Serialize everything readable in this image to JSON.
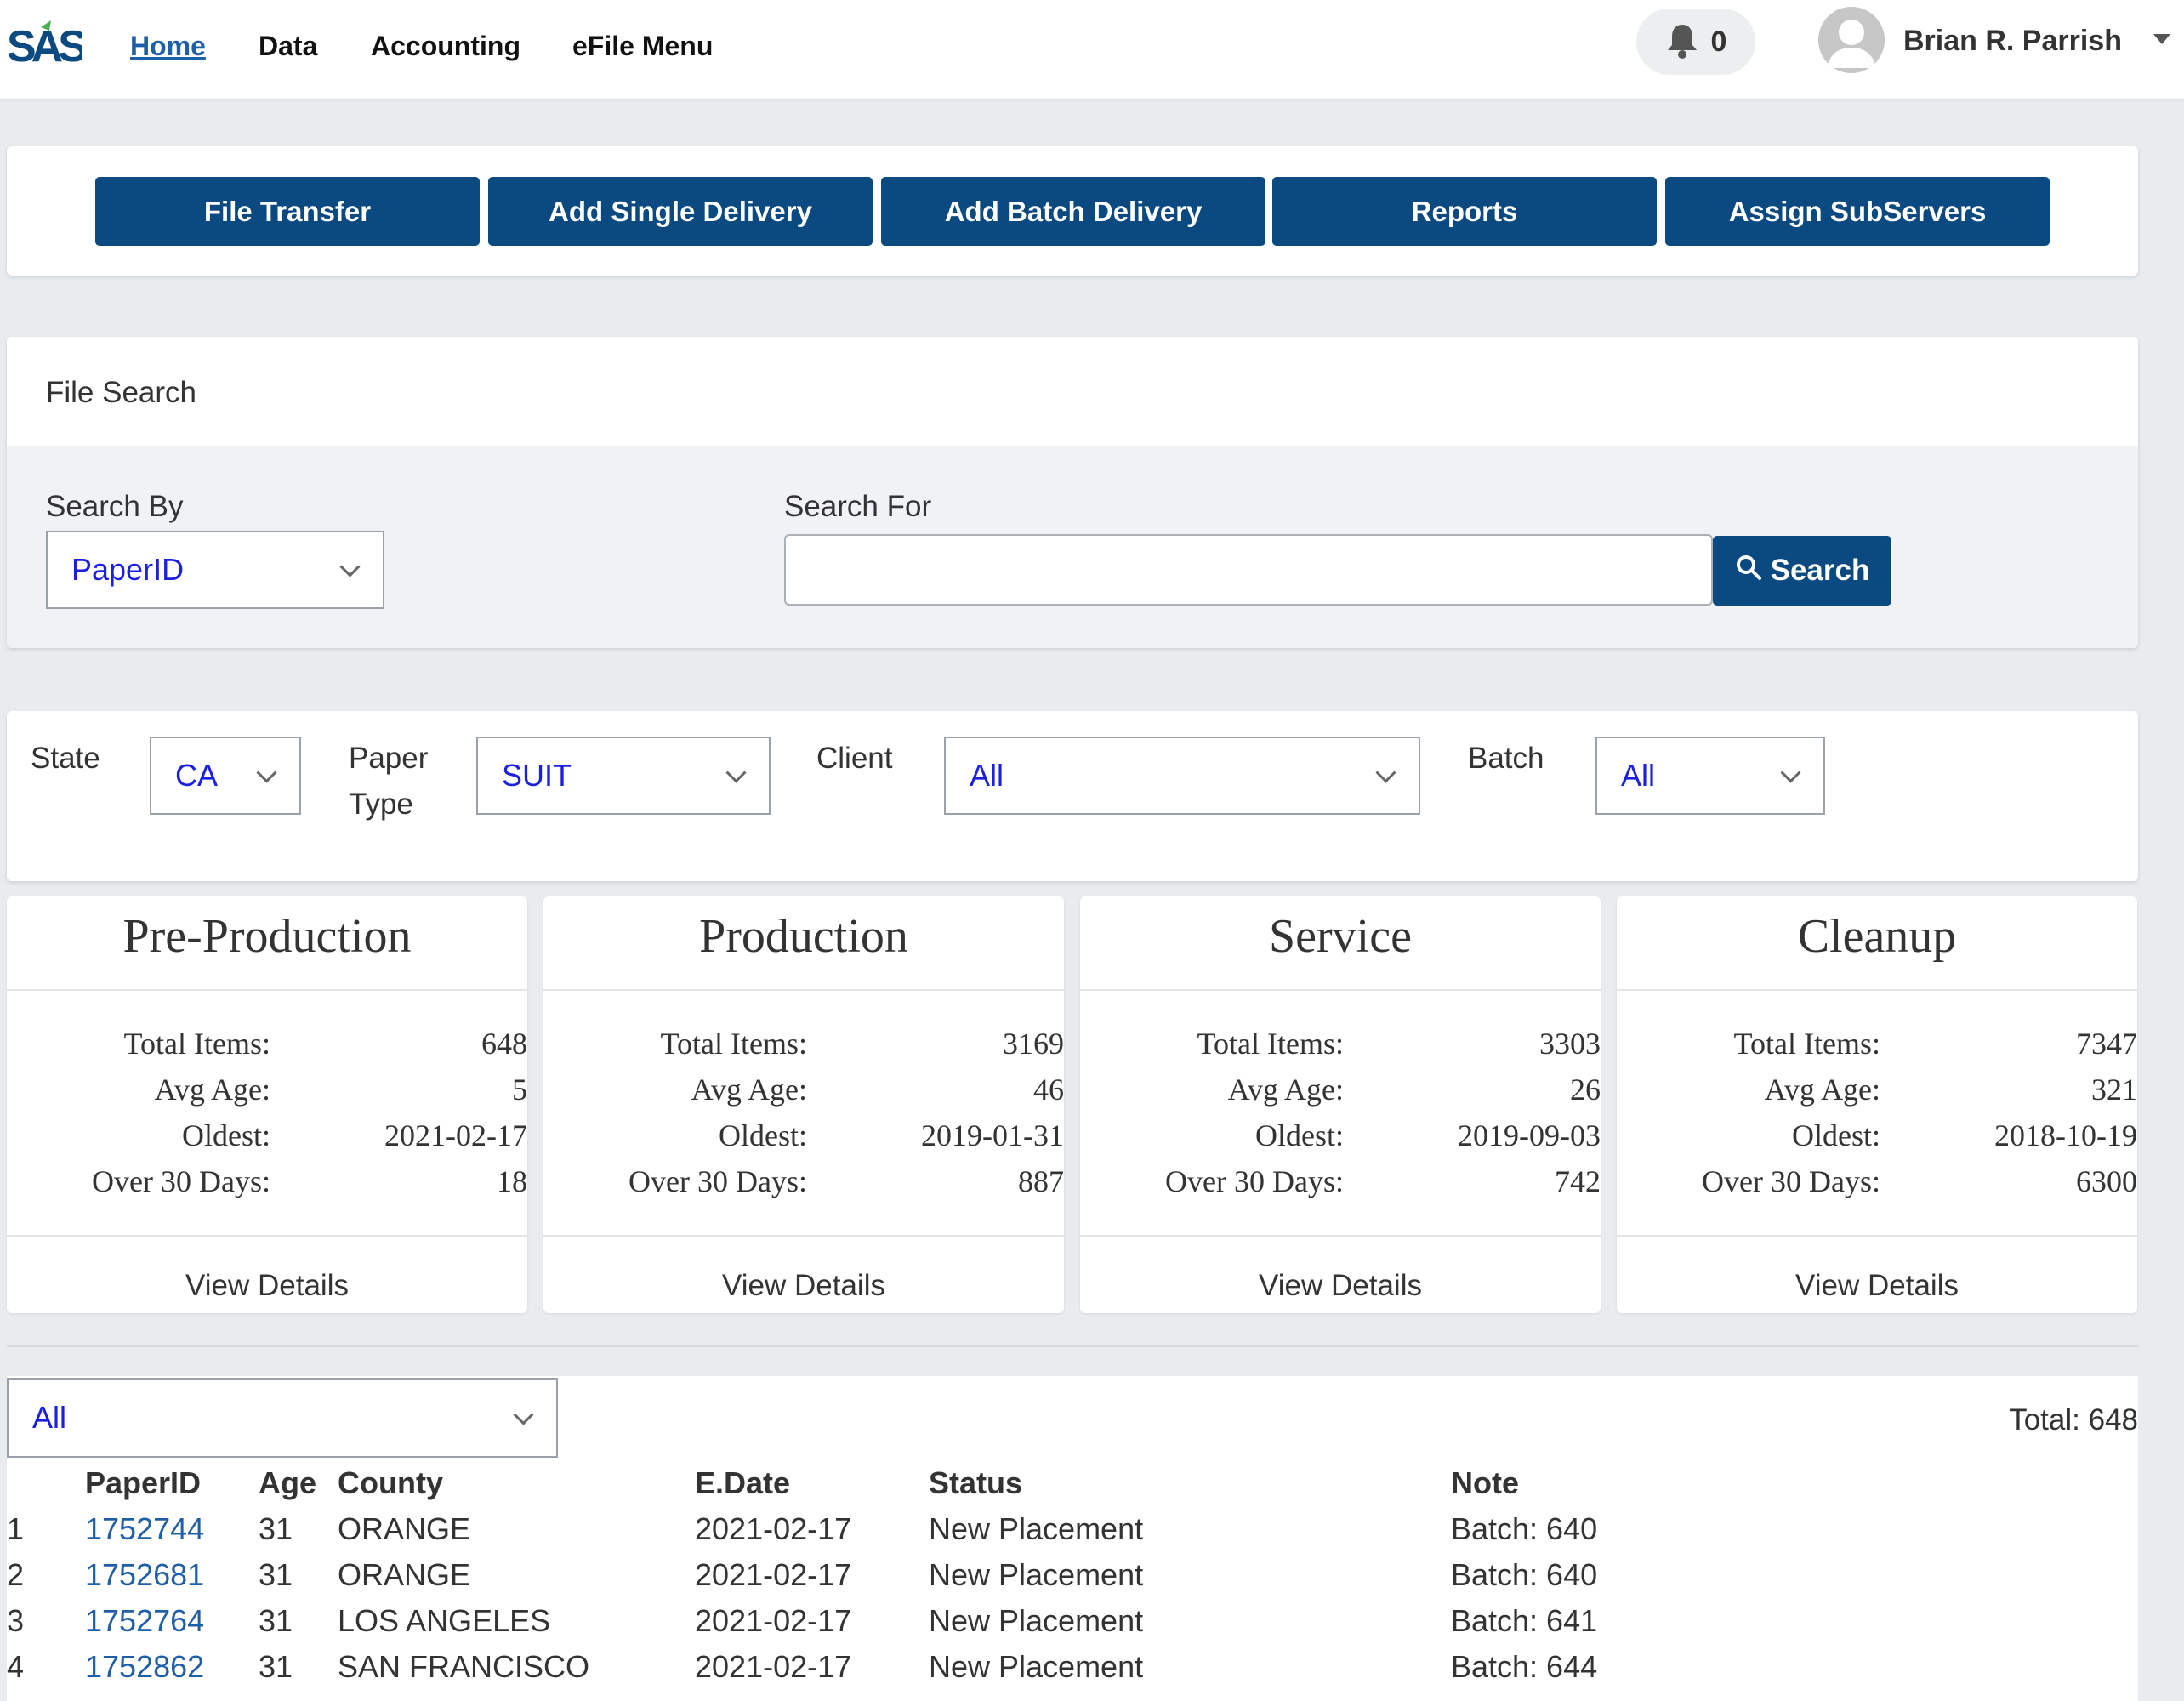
{
  "brand": {
    "logo_text": "SAS",
    "logo_color": "#0b4a80",
    "logo_accent_color": "#4caf50"
  },
  "nav": {
    "items": [
      {
        "label": "Home",
        "active": true
      },
      {
        "label": "Data"
      },
      {
        "label": "Accounting"
      },
      {
        "label": "eFile Menu"
      }
    ],
    "notification_icon": "bell-icon",
    "notification_count": "0",
    "user_name": "Brian R. Parrish",
    "avatar_icon": "user-avatar-icon",
    "user_menu_icon": "caret-down-icon"
  },
  "actions": [
    {
      "label": "File Transfer"
    },
    {
      "label": "Add Single Delivery"
    },
    {
      "label": "Add Batch Delivery"
    },
    {
      "label": "Reports"
    },
    {
      "label": "Assign SubServers"
    }
  ],
  "file_search": {
    "title": "File Search",
    "search_by_label": "Search By",
    "search_by_value": "PaperID",
    "search_for_label": "Search For",
    "search_for_value": "",
    "search_button": "Search",
    "search_icon": "search-icon"
  },
  "filters": {
    "state_label": "State",
    "state_value": "CA",
    "paper_type_label_line1": "Paper",
    "paper_type_label_line2": "Type",
    "paper_type_value": "SUIT",
    "client_label": "Client",
    "client_value": "All",
    "batch_label": "Batch",
    "batch_value": "All"
  },
  "stats_labels": {
    "total_items": "Total Items:",
    "avg_age": "Avg Age:",
    "oldest": "Oldest:",
    "over_30": "Over 30 Days:",
    "view_details": "View Details"
  },
  "stages": [
    {
      "title": "Pre-Production",
      "total_items": "648",
      "avg_age": "5",
      "oldest": "2021-02-17",
      "over_30": "18"
    },
    {
      "title": "Production",
      "total_items": "3169",
      "avg_age": "46",
      "oldest": "2019-01-31",
      "over_30": "887"
    },
    {
      "title": "Service",
      "total_items": "3303",
      "avg_age": "26",
      "oldest": "2019-09-03",
      "over_30": "742"
    },
    {
      "title": "Cleanup",
      "total_items": "7347",
      "avg_age": "321",
      "oldest": "2018-10-19",
      "over_30": "6300"
    }
  ],
  "table": {
    "filter_value": "All",
    "total_label": "Total: 648",
    "columns": [
      "PaperID",
      "Age",
      "County",
      "E.Date",
      "Status",
      "Note"
    ],
    "rows": [
      {
        "index": "1",
        "paper_id": "1752744",
        "age": "31",
        "county": "ORANGE",
        "edate": "2021-02-17",
        "status": "New Placement",
        "note": "Batch: 640"
      },
      {
        "index": "2",
        "paper_id": "1752681",
        "age": "31",
        "county": "ORANGE",
        "edate": "2021-02-17",
        "status": "New Placement",
        "note": "Batch: 640"
      },
      {
        "index": "3",
        "paper_id": "1752764",
        "age": "31",
        "county": "LOS ANGELES",
        "edate": "2021-02-17",
        "status": "New Placement",
        "note": "Batch: 641"
      },
      {
        "index": "4",
        "paper_id": "1752862",
        "age": "31",
        "county": "SAN FRANCISCO",
        "edate": "2021-02-17",
        "status": "New Placement",
        "note": "Batch: 644"
      }
    ]
  }
}
